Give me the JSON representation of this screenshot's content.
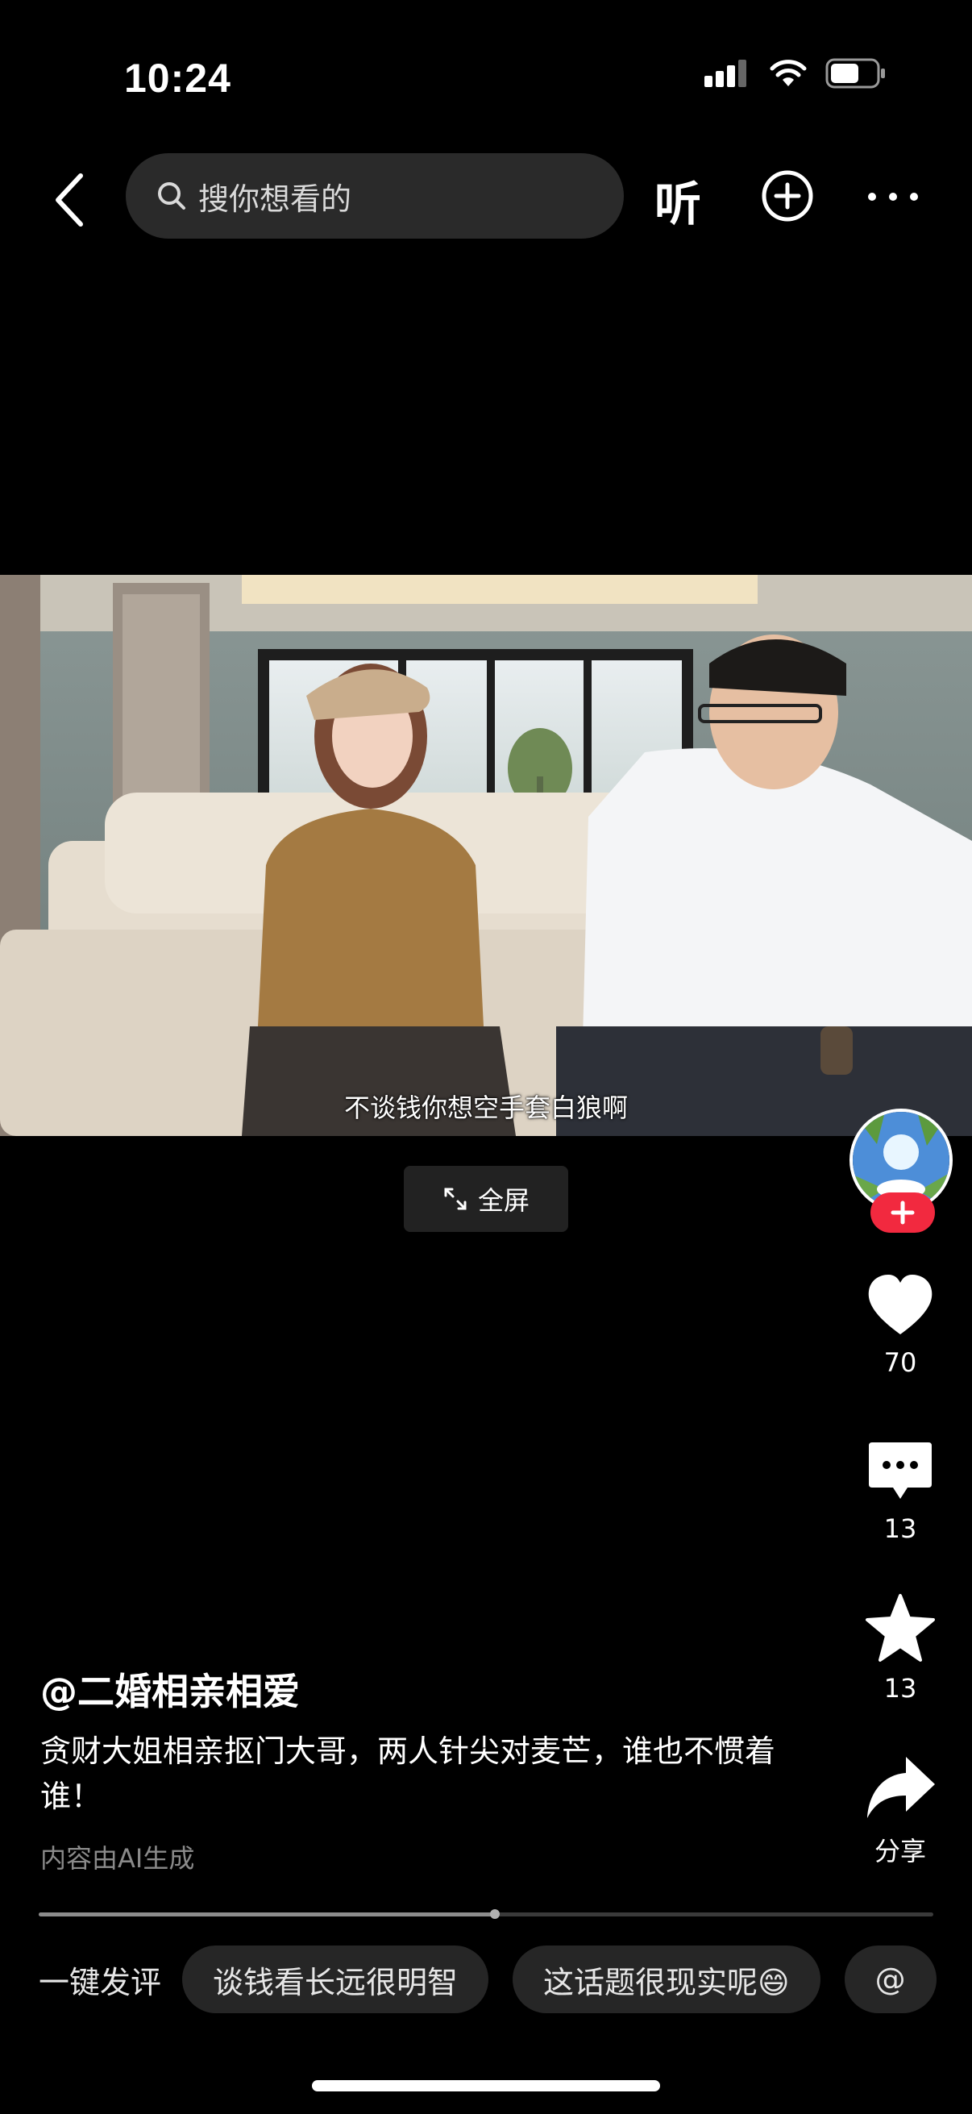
{
  "status": {
    "time": "10:24"
  },
  "top_bar": {
    "search_placeholder": "搜你想看的",
    "listen_label": "听"
  },
  "video": {
    "subtitle": "不谈钱你想空手套白狼啊",
    "fullscreen_label": "全屏"
  },
  "actions": {
    "likes": "70",
    "comments": "13",
    "favorites": "13",
    "share_label": "分享"
  },
  "post": {
    "author": "@二婚相亲相爱",
    "description": "贪财大姐相亲抠门大哥，两人针尖对麦芒，谁也不惯着谁！",
    "ai_note": "内容由AI生成"
  },
  "playback": {
    "progress_fraction": 0.51
  },
  "quick_comment": {
    "label": "一键发评",
    "chips": [
      "谈钱看长远很明智",
      "这话题很现实呢😄",
      "@"
    ]
  },
  "icons": [
    "back-icon",
    "search-icon",
    "add-icon",
    "more-icon",
    "fullscreen-icon",
    "heart-icon",
    "comment-icon",
    "star-icon",
    "share-icon",
    "follow-plus-icon"
  ],
  "colors": {
    "background": "#000000",
    "follow": "#f2293f",
    "chip": "#262626"
  }
}
